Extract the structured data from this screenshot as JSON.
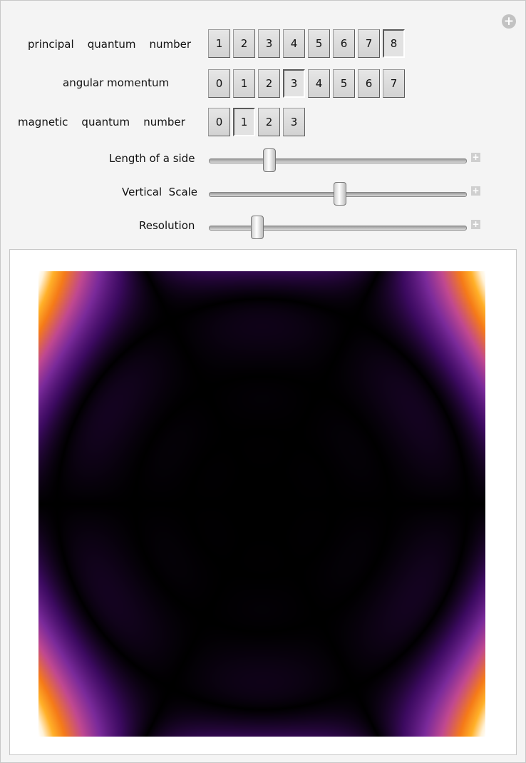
{
  "controls": {
    "principal": {
      "label": "principal    quantum    number",
      "options": [
        "1",
        "2",
        "3",
        "4",
        "5",
        "6",
        "7",
        "8"
      ],
      "selected": "8"
    },
    "angular": {
      "label": "angular momentum",
      "options": [
        "0",
        "1",
        "2",
        "3",
        "4",
        "5",
        "6",
        "7"
      ],
      "selected": "3"
    },
    "magnetic": {
      "label": "magnetic    quantum    number",
      "options": [
        "0",
        "1",
        "2",
        "3"
      ],
      "selected": "1"
    },
    "side_length": {
      "label": "Length of a side",
      "fraction": 0.22
    },
    "vertical_scale": {
      "label": "Vertical  Scale",
      "fraction": 0.51
    },
    "resolution": {
      "label": "Resolution",
      "fraction": 0.17
    }
  },
  "icons": {
    "add": "plus-circle-icon",
    "slider_expand": "plus-square-icon"
  },
  "plot": {
    "colormap": [
      "#000000",
      "#3c0a60",
      "#7a2a9a",
      "#c04890",
      "#f57a18",
      "#ffb028",
      "#fff2d8",
      "#ffffff"
    ]
  }
}
